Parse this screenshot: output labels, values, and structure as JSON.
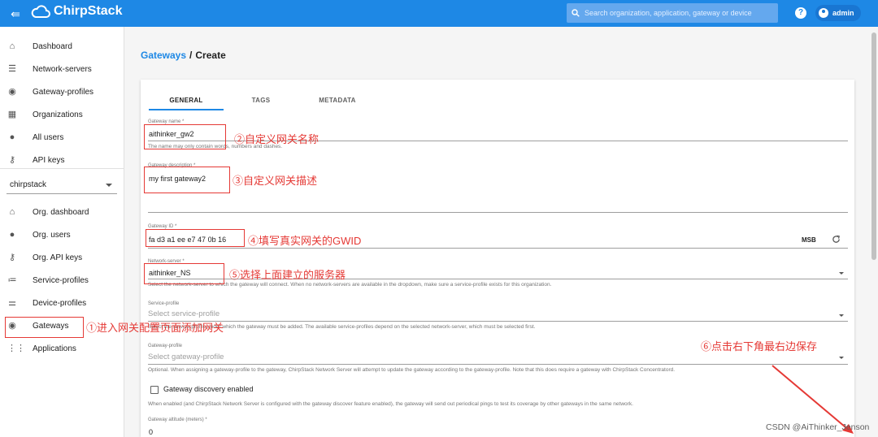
{
  "app": {
    "title": "ChirpStack"
  },
  "search": {
    "placeholder": "Search organization, application, gateway or device"
  },
  "header": {
    "help_icon": "help-icon",
    "user_label": "admin"
  },
  "sidebar": {
    "items": [
      {
        "label": "Dashboard",
        "icon": "home-icon"
      },
      {
        "label": "Network-servers",
        "icon": "server-icon"
      },
      {
        "label": "Gateway-profiles",
        "icon": "wifi-tethering-icon"
      },
      {
        "label": "Organizations",
        "icon": "domain-icon"
      },
      {
        "label": "All users",
        "icon": "person-icon"
      },
      {
        "label": "API keys",
        "icon": "key-icon"
      }
    ],
    "org_select": {
      "value": "chirpstack"
    },
    "org_items": [
      {
        "label": "Org. dashboard",
        "icon": "home-icon"
      },
      {
        "label": "Org. users",
        "icon": "person-icon"
      },
      {
        "label": "Org. API keys",
        "icon": "key-icon"
      },
      {
        "label": "Service-profiles",
        "icon": "list-icon"
      },
      {
        "label": "Device-profiles",
        "icon": "tune-icon"
      },
      {
        "label": "Gateways",
        "icon": "wifi-tethering-icon"
      },
      {
        "label": "Applications",
        "icon": "apps-icon"
      }
    ]
  },
  "breadcrumb": {
    "parent": "Gateways",
    "separator": "/",
    "current": "Create"
  },
  "tabs": [
    "GENERAL",
    "TAGS",
    "METADATA"
  ],
  "form": {
    "gateway_name": {
      "label": "Gateway name *",
      "value": "aithinker_gw2",
      "helper": "The name may only contain words, numbers and dashes."
    },
    "gateway_description": {
      "label": "Gateway description *",
      "value": "my first gateway2"
    },
    "gateway_id": {
      "label": "Gateway ID *",
      "value": "fa d3 a1 ee e7 47 0b 16",
      "msb": "MSB"
    },
    "network_server": {
      "label": "Network-server *",
      "value": "aithinker_NS",
      "helper": "Select the network-server to which the gateway will connect. When no network-servers are available in the dropdown, make sure a service-profile exists for this organization."
    },
    "service_profile": {
      "label": "Service-profile",
      "placeholder": "Select service-profile",
      "helper": "Select the service-profile under which the gateway must be added. The available service-profiles depend on the selected network-server, which must be selected first."
    },
    "gateway_profile": {
      "label": "Gateway-profile",
      "placeholder": "Select gateway-profile",
      "helper": "Optional. When assigning a gateway-profile to the gateway, ChirpStack Network Server will attempt to update the gateway according to the gateway-profile. Note that this does require a gateway with ChirpStack Concentratord."
    },
    "discovery": {
      "label": "Gateway discovery enabled",
      "helper": "When enabled (and ChirpStack Network Server is configured with the gateway discover feature enabled), the gateway will send out periodical pings to test its coverage by other gateways in the same network."
    },
    "altitude": {
      "label": "Gateway altitude (meters) *",
      "value": "0"
    }
  },
  "annotations": {
    "a1": "①进入网关配置页面添加网关",
    "a2": "②自定义网关名称",
    "a3": "③自定义网关描述",
    "a4": "④填写真实网关的GWID",
    "a5": "⑤选择上面建立的服务器",
    "a6": "⑥点击右下角最右边保存"
  },
  "watermark": "CSDN @AiThinker_Jenson",
  "colors": {
    "primary": "#1e88e5",
    "annotation": "#e53935"
  }
}
